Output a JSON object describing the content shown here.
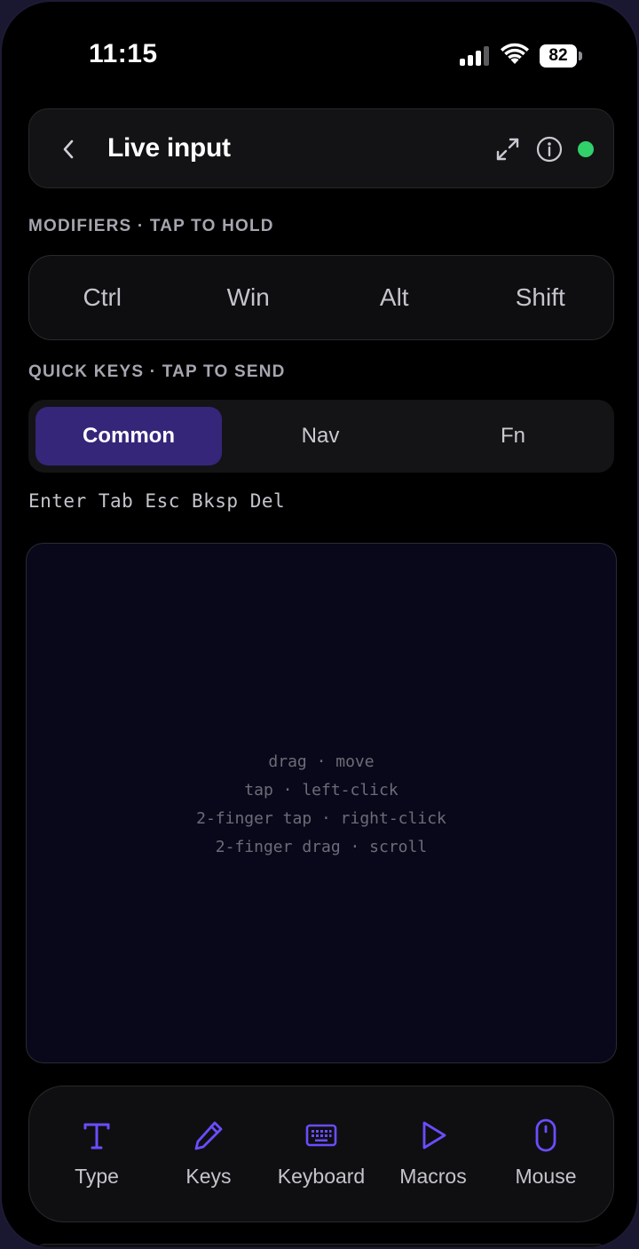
{
  "status_bar": {
    "time": "11:15",
    "battery": "82"
  },
  "header": {
    "title": "Live input",
    "connected_color": "#32d06a"
  },
  "modifiers": {
    "label": "MODIFIERS · TAP TO HOLD",
    "keys": [
      "Ctrl",
      "Win",
      "Alt",
      "Shift"
    ]
  },
  "quick_keys": {
    "label": "QUICK KEYS · TAP TO SEND",
    "tabs": [
      "Common",
      "Nav",
      "Fn"
    ],
    "active_tab": "Common",
    "keys_text": "Enter Tab Esc Bksp Del"
  },
  "trackpad": {
    "hints": [
      "drag · move",
      "tap · left-click",
      "2-finger tap · right-click",
      "2-finger drag · scroll"
    ]
  },
  "tabbar": {
    "items": [
      {
        "label": "Type",
        "icon": "type-icon"
      },
      {
        "label": "Keys",
        "icon": "pencil-icon"
      },
      {
        "label": "Keyboard",
        "icon": "keyboard-icon"
      },
      {
        "label": "Macros",
        "icon": "play-icon"
      },
      {
        "label": "Mouse",
        "icon": "mouse-icon"
      }
    ],
    "accent": "#6a4dff"
  }
}
